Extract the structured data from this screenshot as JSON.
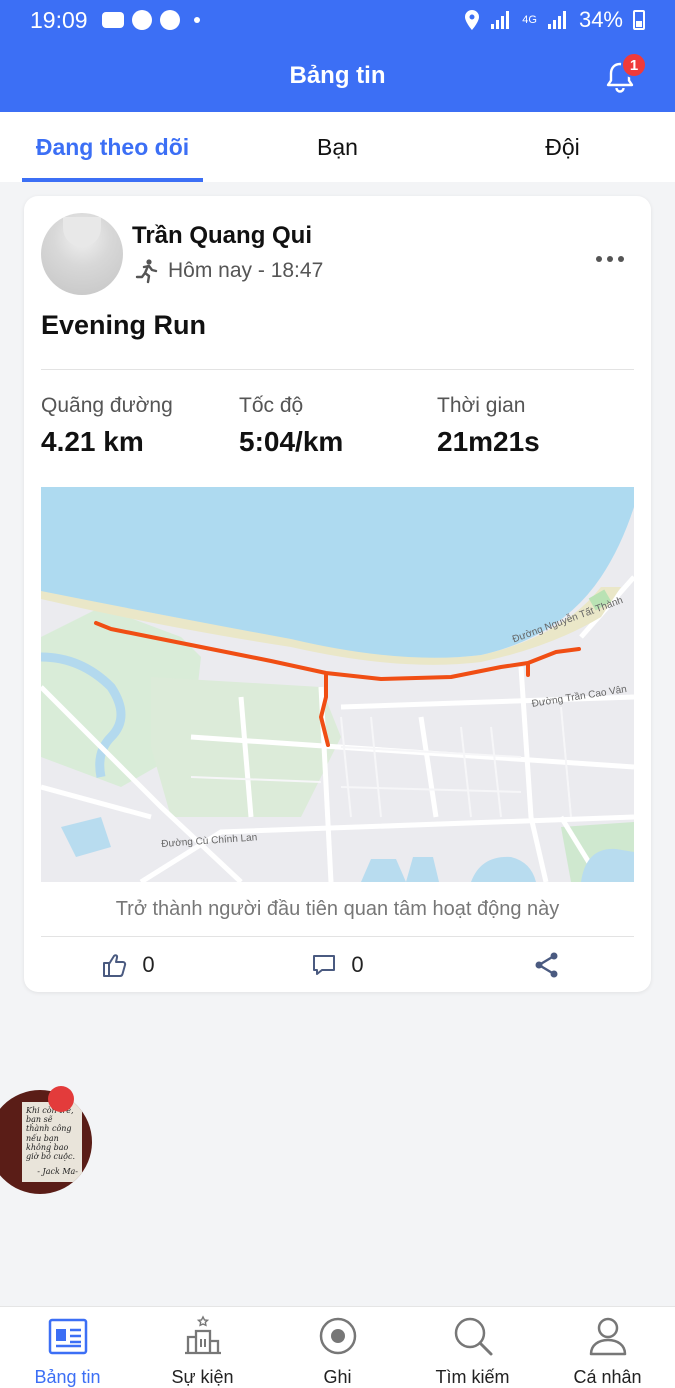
{
  "status_bar": {
    "time": "19:09",
    "network": "4G",
    "battery": "34%"
  },
  "header": {
    "title": "Bảng tin",
    "notification_count": "1"
  },
  "tabs": [
    {
      "label": "Đang theo dõi",
      "active": true
    },
    {
      "label": "Bạn",
      "active": false
    },
    {
      "label": "Đội",
      "active": false
    }
  ],
  "activity": {
    "athlete_name": "Trần Quang Qui",
    "timestamp": "Hôm nay - 18:47",
    "title": "Evening Run",
    "stats": [
      {
        "label": "Quãng đường",
        "value": "4.21 km"
      },
      {
        "label": "Tốc độ",
        "value": "5:04/km"
      },
      {
        "label": "Thời gian",
        "value": "21m21s"
      }
    ],
    "map_labels": {
      "road_1": "Đường Nguyễn Tất Thành",
      "road_2": "Đường Trần Cao Vân",
      "road_3": "Đường Cù Chính Lan"
    },
    "kudos_prompt": "Trở thành người đầu tiên quan tâm hoạt động này",
    "likes": "0",
    "comments": "0"
  },
  "floating_bubble": {
    "quote": "Khi còn trẻ, bạn sẽ thành công nếu bạn không bao giờ bỏ cuộc.",
    "author": "- Jack Ma-"
  },
  "bottom_nav": [
    {
      "label": "Bảng tin",
      "icon": "feed-icon",
      "active": true
    },
    {
      "label": "Sự kiện",
      "icon": "events-icon",
      "active": false
    },
    {
      "label": "Ghi",
      "icon": "record-icon",
      "active": false
    },
    {
      "label": "Tìm kiếm",
      "icon": "search-icon",
      "active": false
    },
    {
      "label": "Cá nhân",
      "icon": "profile-icon",
      "active": false
    }
  ],
  "colors": {
    "brand": "#3c6ff5",
    "route": "#f04e14",
    "water": "#aedaf0",
    "badge": "#f03a3a"
  }
}
